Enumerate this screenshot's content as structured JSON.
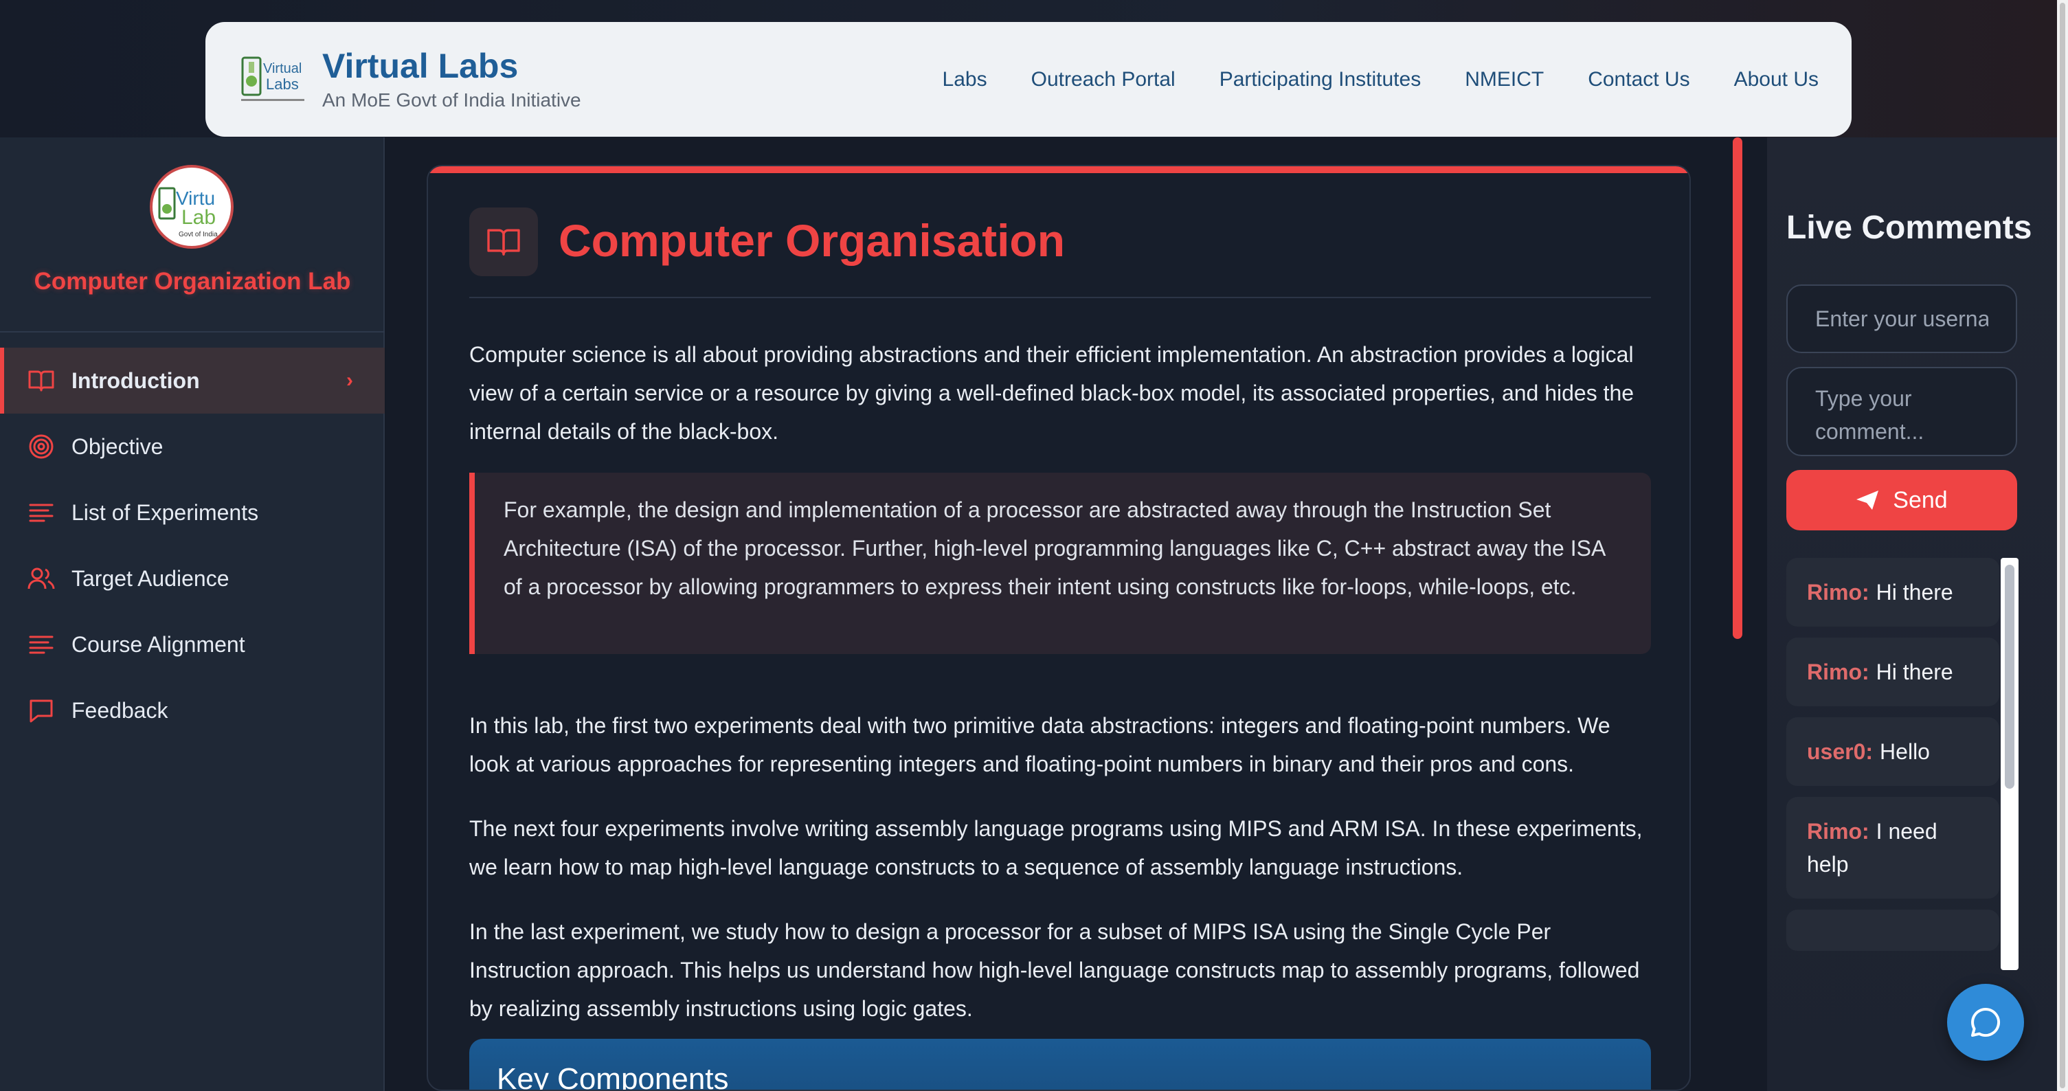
{
  "header": {
    "brand_title": "Virtual Labs",
    "brand_subtitle": "An MoE Govt of India Initiative",
    "nav": [
      "Labs",
      "Outreach Portal",
      "Participating Institutes",
      "NMEICT",
      "Contact Us",
      "About Us"
    ]
  },
  "sidebar": {
    "lab_title": "Computer Organization Lab",
    "items": [
      {
        "label": "Introduction",
        "icon": "book-icon",
        "active": true
      },
      {
        "label": "Objective",
        "icon": "target-icon"
      },
      {
        "label": "List of Experiments",
        "icon": "list-icon"
      },
      {
        "label": "Target Audience",
        "icon": "users-icon"
      },
      {
        "label": "Course Alignment",
        "icon": "list-icon"
      },
      {
        "label": "Feedback",
        "icon": "message-icon"
      }
    ]
  },
  "main": {
    "title": "Computer Organisation",
    "p1": "Computer science is all about providing abstractions and their efficient implementation. An abstraction provides a logical view of a certain service or a resource by giving a well-defined black-box model, its associated properties, and hides the internal details of the black-box.",
    "quote": "For example, the design and implementation of a processor are abstracted away through the Instruction Set Architecture (ISA) of the processor. Further, high-level programming languages like C, C++ abstract away the ISA of a processor by allowing programmers to express their intent using constructs like for-loops, while-loops, etc.",
    "p2": "In this lab, the first two experiments deal with two primitive data abstractions: integers and floating-point numbers. We look at various approaches for representing integers and floating-point numbers in binary and their pros and cons.",
    "p3": "The next four experiments involve writing assembly language programs using MIPS and ARM ISA. In these experiments, we learn how to map high-level language constructs to a sequence of assembly language instructions.",
    "p4": "In the last experiment, we study how to design a processor for a subset of MIPS ISA using the Single Cycle Per Instruction approach. This helps us understand how high-level language constructs map to assembly programs, followed by realizing assembly instructions using logic gates.",
    "key_components_title": "Key Components"
  },
  "comments": {
    "title": "Live Comments",
    "username_placeholder": "Enter your username",
    "comment_placeholder": "Type your comment...",
    "send_label": "Send",
    "messages": [
      {
        "user": "Rimo:",
        "text": "Hi there"
      },
      {
        "user": "Rimo:",
        "text": "Hi there"
      },
      {
        "user": "user0:",
        "text": "Hello"
      },
      {
        "user": "Rimo:",
        "text": "I need help"
      }
    ]
  },
  "colors": {
    "accent": "#ef4444",
    "brand": "#1f5e97",
    "fab": "#2f8bd8"
  }
}
